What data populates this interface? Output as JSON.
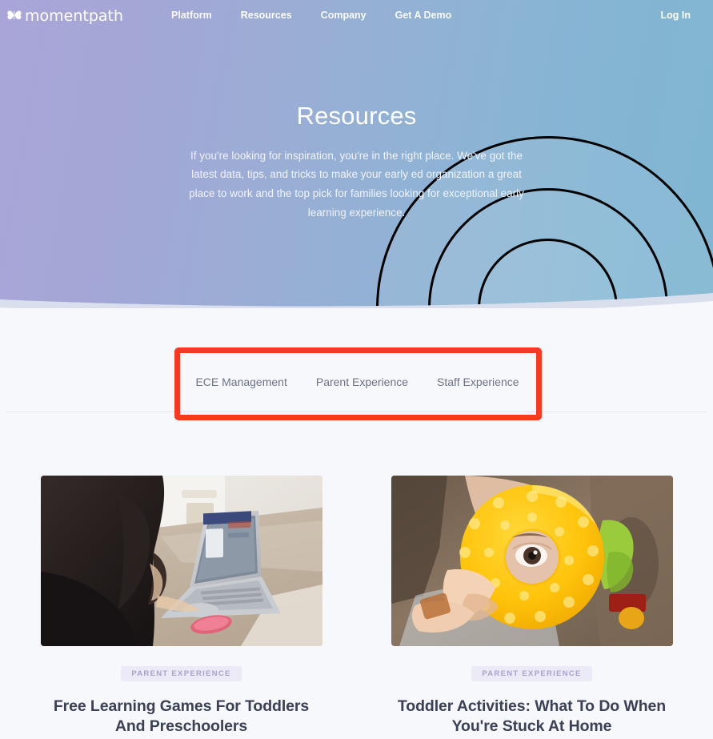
{
  "brand": {
    "logo_text": "momentpath",
    "logo_icon": "butterfly-icon"
  },
  "nav": {
    "links": [
      {
        "label": "Platform",
        "active": false
      },
      {
        "label": "Resources",
        "active": true
      },
      {
        "label": "Company",
        "active": false
      },
      {
        "label": "Get A Demo",
        "active": false
      }
    ],
    "login_label": "Log In"
  },
  "hero": {
    "title": "Resources",
    "subtitle": "If you're looking for inspiration, you're in the right place. We've got the latest data, tips, and tricks to make your early ed organization a great place to work and the top pick for families looking for exceptional early learning experience.",
    "gradient_from": "#a9a5d8",
    "gradient_to": "#80b6d2"
  },
  "filters": {
    "tabs": [
      {
        "label": "ECE Management"
      },
      {
        "label": "Parent Experience"
      },
      {
        "label": "Staff Experience"
      }
    ],
    "highlight_color": "#f93822"
  },
  "cards": [
    {
      "badge": "Parent Experience",
      "title": "Free Learning Games For Toddlers And Preschoolers",
      "image_alt": "girl-with-laptop-photo"
    },
    {
      "badge": "Parent Experience",
      "title": "Toddler Activities: What To Do When You're Stuck At Home",
      "image_alt": "toddler-with-yellow-ring-toy-photo"
    }
  ],
  "theme": {
    "page_background": "#f7f8fc",
    "badge_background": "#eceaf6",
    "badge_text": "#a9a2c8",
    "title_text": "#3b4154",
    "tab_text": "#6d7484"
  }
}
